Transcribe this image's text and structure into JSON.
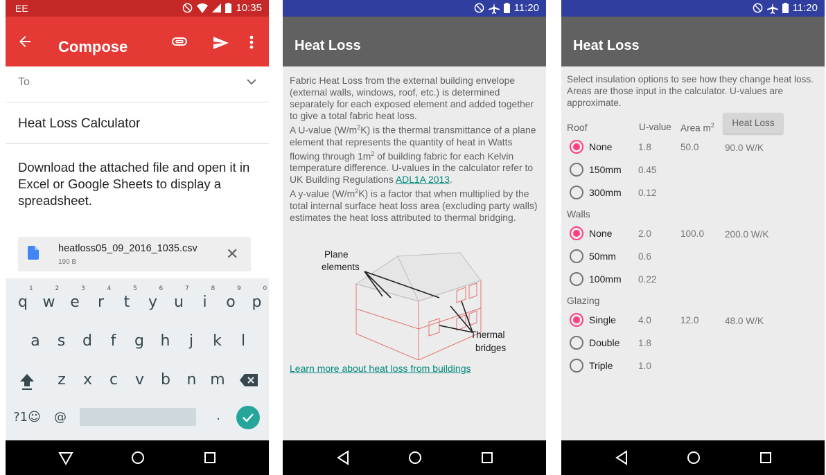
{
  "phone1": {
    "status": {
      "carrier": "EE",
      "time": "10:35"
    },
    "app_title": "Compose",
    "to_label": "To",
    "subject": "Heat Loss Calculator",
    "body": "Download the attached file and open it in Excel or Google Sheets to display a spreadsheet.",
    "attachment": {
      "name": "heatloss05_09_2016_1035.csv",
      "size": "190 B"
    },
    "keyboard": {
      "row1": [
        {
          "k": "q",
          "n": "1"
        },
        {
          "k": "w",
          "n": "2"
        },
        {
          "k": "e",
          "n": "3"
        },
        {
          "k": "r",
          "n": "4"
        },
        {
          "k": "t",
          "n": "5"
        },
        {
          "k": "y",
          "n": "6"
        },
        {
          "k": "u",
          "n": "7"
        },
        {
          "k": "i",
          "n": "8"
        },
        {
          "k": "o",
          "n": "9"
        },
        {
          "k": "p",
          "n": "0"
        }
      ],
      "row2": [
        "a",
        "s",
        "d",
        "f",
        "g",
        "h",
        "j",
        "k",
        "l"
      ],
      "row3": [
        "z",
        "x",
        "c",
        "v",
        "b",
        "n",
        "m"
      ],
      "symbols_label": "?1☺",
      "at_label": "@",
      "period_label": "."
    }
  },
  "phone2": {
    "status": {
      "time": "11:20"
    },
    "app_title": "Heat Loss",
    "para1": "Fabric Heat Loss from the external building envelope (external walls, windows, roof, etc.) is determined separately for each exposed element and added together to give a total fabric heat loss.",
    "para2_a": "A U-value (W/m",
    "para2_b": "K) is the thermal transmittance of a plane element that represents the quantity of heat in Watts flowing through 1m",
    "para2_c": " of building fabric for each Kelvin temperature difference. U-values in the calculator refer to UK Building Regulations ",
    "para2_link": "ADL1A 2013",
    "para2_d": ".",
    "para3_a": "A y-value (W/m",
    "para3_b": "K) is a factor that when multiplied by the total internal surface heat loss area (excluding party walls) estimates the heat loss attributed to thermal bridging.",
    "sup2": "2",
    "diagram": {
      "plane_line1": "Plane",
      "plane_line2": "elements",
      "thermal_line1": "Thermal",
      "thermal_line2": "bridges"
    },
    "learn_more": "Learn more about heat loss from buildings"
  },
  "phone3": {
    "status": {
      "time": "11:20"
    },
    "app_title": "Heat Loss",
    "intro": "Select insulation options to see how they change heat loss. Areas are those input in the calculator. U-values are approximate.",
    "col_uvalue": "U-value",
    "col_area": "Area m",
    "col_area_sup": "2",
    "heat_loss_button": "Heat Loss",
    "groups": [
      {
        "name": "Roof",
        "options": [
          {
            "label": "None",
            "selected": true,
            "uvalue": "1.8",
            "area": "50.0",
            "loss": "90.0 W/K"
          },
          {
            "label": "150mm",
            "selected": false,
            "uvalue": "0.45",
            "area": "",
            "loss": ""
          },
          {
            "label": "300mm",
            "selected": false,
            "uvalue": "0.12",
            "area": "",
            "loss": ""
          }
        ]
      },
      {
        "name": "Walls",
        "options": [
          {
            "label": "None",
            "selected": true,
            "uvalue": "2.0",
            "area": "100.0",
            "loss": "200.0 W/K"
          },
          {
            "label": "50mm",
            "selected": false,
            "uvalue": "0.6",
            "area": "",
            "loss": ""
          },
          {
            "label": "100mm",
            "selected": false,
            "uvalue": "0.22",
            "area": "",
            "loss": ""
          }
        ]
      },
      {
        "name": "Glazing",
        "options": [
          {
            "label": "Single",
            "selected": true,
            "uvalue": "4.0",
            "area": "12.0",
            "loss": "48.0 W/K"
          },
          {
            "label": "Double",
            "selected": false,
            "uvalue": "1.8",
            "area": "",
            "loss": ""
          },
          {
            "label": "Triple",
            "selected": false,
            "uvalue": "1.0",
            "area": "",
            "loss": ""
          }
        ]
      }
    ]
  },
  "colors": {
    "gmail_red": "#e53935",
    "gmail_status": "#c62828",
    "indigo_status": "#303f9f",
    "appbar_grey": "#616161",
    "radio_pink": "#ff4081",
    "link_teal": "#00897b",
    "enter_teal": "#26a69a"
  }
}
